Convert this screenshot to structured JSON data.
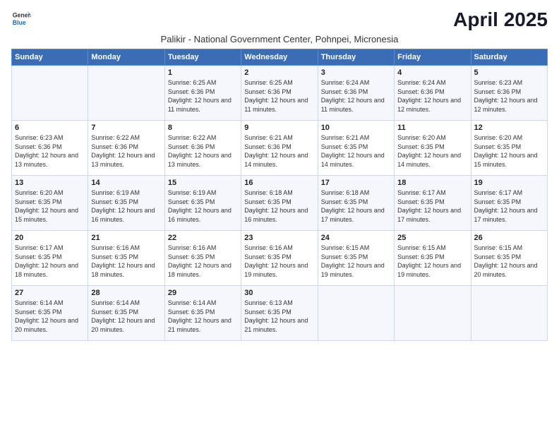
{
  "logo": {
    "general": "General",
    "blue": "Blue"
  },
  "title": "April 2025",
  "subtitle": "Palikir - National Government Center, Pohnpei, Micronesia",
  "weekdays": [
    "Sunday",
    "Monday",
    "Tuesday",
    "Wednesday",
    "Thursday",
    "Friday",
    "Saturday"
  ],
  "weeks": [
    [
      {
        "day": "",
        "sunrise": "",
        "sunset": "",
        "daylight": ""
      },
      {
        "day": "",
        "sunrise": "",
        "sunset": "",
        "daylight": ""
      },
      {
        "day": "1",
        "sunrise": "Sunrise: 6:25 AM",
        "sunset": "Sunset: 6:36 PM",
        "daylight": "Daylight: 12 hours and 11 minutes."
      },
      {
        "day": "2",
        "sunrise": "Sunrise: 6:25 AM",
        "sunset": "Sunset: 6:36 PM",
        "daylight": "Daylight: 12 hours and 11 minutes."
      },
      {
        "day": "3",
        "sunrise": "Sunrise: 6:24 AM",
        "sunset": "Sunset: 6:36 PM",
        "daylight": "Daylight: 12 hours and 11 minutes."
      },
      {
        "day": "4",
        "sunrise": "Sunrise: 6:24 AM",
        "sunset": "Sunset: 6:36 PM",
        "daylight": "Daylight: 12 hours and 12 minutes."
      },
      {
        "day": "5",
        "sunrise": "Sunrise: 6:23 AM",
        "sunset": "Sunset: 6:36 PM",
        "daylight": "Daylight: 12 hours and 12 minutes."
      }
    ],
    [
      {
        "day": "6",
        "sunrise": "Sunrise: 6:23 AM",
        "sunset": "Sunset: 6:36 PM",
        "daylight": "Daylight: 12 hours and 13 minutes."
      },
      {
        "day": "7",
        "sunrise": "Sunrise: 6:22 AM",
        "sunset": "Sunset: 6:36 PM",
        "daylight": "Daylight: 12 hours and 13 minutes."
      },
      {
        "day": "8",
        "sunrise": "Sunrise: 6:22 AM",
        "sunset": "Sunset: 6:36 PM",
        "daylight": "Daylight: 12 hours and 13 minutes."
      },
      {
        "day": "9",
        "sunrise": "Sunrise: 6:21 AM",
        "sunset": "Sunset: 6:36 PM",
        "daylight": "Daylight: 12 hours and 14 minutes."
      },
      {
        "day": "10",
        "sunrise": "Sunrise: 6:21 AM",
        "sunset": "Sunset: 6:35 PM",
        "daylight": "Daylight: 12 hours and 14 minutes."
      },
      {
        "day": "11",
        "sunrise": "Sunrise: 6:20 AM",
        "sunset": "Sunset: 6:35 PM",
        "daylight": "Daylight: 12 hours and 14 minutes."
      },
      {
        "day": "12",
        "sunrise": "Sunrise: 6:20 AM",
        "sunset": "Sunset: 6:35 PM",
        "daylight": "Daylight: 12 hours and 15 minutes."
      }
    ],
    [
      {
        "day": "13",
        "sunrise": "Sunrise: 6:20 AM",
        "sunset": "Sunset: 6:35 PM",
        "daylight": "Daylight: 12 hours and 15 minutes."
      },
      {
        "day": "14",
        "sunrise": "Sunrise: 6:19 AM",
        "sunset": "Sunset: 6:35 PM",
        "daylight": "Daylight: 12 hours and 16 minutes."
      },
      {
        "day": "15",
        "sunrise": "Sunrise: 6:19 AM",
        "sunset": "Sunset: 6:35 PM",
        "daylight": "Daylight: 12 hours and 16 minutes."
      },
      {
        "day": "16",
        "sunrise": "Sunrise: 6:18 AM",
        "sunset": "Sunset: 6:35 PM",
        "daylight": "Daylight: 12 hours and 16 minutes."
      },
      {
        "day": "17",
        "sunrise": "Sunrise: 6:18 AM",
        "sunset": "Sunset: 6:35 PM",
        "daylight": "Daylight: 12 hours and 17 minutes."
      },
      {
        "day": "18",
        "sunrise": "Sunrise: 6:17 AM",
        "sunset": "Sunset: 6:35 PM",
        "daylight": "Daylight: 12 hours and 17 minutes."
      },
      {
        "day": "19",
        "sunrise": "Sunrise: 6:17 AM",
        "sunset": "Sunset: 6:35 PM",
        "daylight": "Daylight: 12 hours and 17 minutes."
      }
    ],
    [
      {
        "day": "20",
        "sunrise": "Sunrise: 6:17 AM",
        "sunset": "Sunset: 6:35 PM",
        "daylight": "Daylight: 12 hours and 18 minutes."
      },
      {
        "day": "21",
        "sunrise": "Sunrise: 6:16 AM",
        "sunset": "Sunset: 6:35 PM",
        "daylight": "Daylight: 12 hours and 18 minutes."
      },
      {
        "day": "22",
        "sunrise": "Sunrise: 6:16 AM",
        "sunset": "Sunset: 6:35 PM",
        "daylight": "Daylight: 12 hours and 18 minutes."
      },
      {
        "day": "23",
        "sunrise": "Sunrise: 6:16 AM",
        "sunset": "Sunset: 6:35 PM",
        "daylight": "Daylight: 12 hours and 19 minutes."
      },
      {
        "day": "24",
        "sunrise": "Sunrise: 6:15 AM",
        "sunset": "Sunset: 6:35 PM",
        "daylight": "Daylight: 12 hours and 19 minutes."
      },
      {
        "day": "25",
        "sunrise": "Sunrise: 6:15 AM",
        "sunset": "Sunset: 6:35 PM",
        "daylight": "Daylight: 12 hours and 19 minutes."
      },
      {
        "day": "26",
        "sunrise": "Sunrise: 6:15 AM",
        "sunset": "Sunset: 6:35 PM",
        "daylight": "Daylight: 12 hours and 20 minutes."
      }
    ],
    [
      {
        "day": "27",
        "sunrise": "Sunrise: 6:14 AM",
        "sunset": "Sunset: 6:35 PM",
        "daylight": "Daylight: 12 hours and 20 minutes."
      },
      {
        "day": "28",
        "sunrise": "Sunrise: 6:14 AM",
        "sunset": "Sunset: 6:35 PM",
        "daylight": "Daylight: 12 hours and 20 minutes."
      },
      {
        "day": "29",
        "sunrise": "Sunrise: 6:14 AM",
        "sunset": "Sunset: 6:35 PM",
        "daylight": "Daylight: 12 hours and 21 minutes."
      },
      {
        "day": "30",
        "sunrise": "Sunrise: 6:13 AM",
        "sunset": "Sunset: 6:35 PM",
        "daylight": "Daylight: 12 hours and 21 minutes."
      },
      {
        "day": "",
        "sunrise": "",
        "sunset": "",
        "daylight": ""
      },
      {
        "day": "",
        "sunrise": "",
        "sunset": "",
        "daylight": ""
      },
      {
        "day": "",
        "sunrise": "",
        "sunset": "",
        "daylight": ""
      }
    ]
  ]
}
